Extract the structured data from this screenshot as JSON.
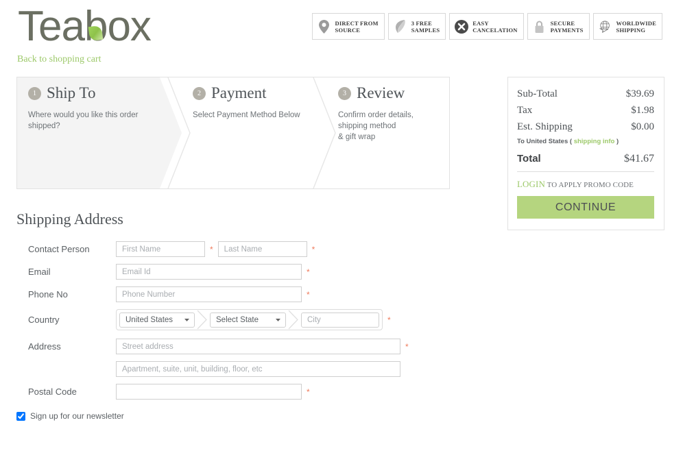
{
  "header": {
    "logo_text": "Teabox",
    "back_link": "Back to shopping cart",
    "badges": [
      {
        "icon": "map-pin-icon",
        "label": "DIRECT FROM\nSOURCE"
      },
      {
        "icon": "leaf-icon",
        "label": "3 FREE\nSAMPLES"
      },
      {
        "icon": "x-circle-icon",
        "label": "EASY\nCANCELATION"
      },
      {
        "icon": "lock-icon",
        "label": "SECURE\nPAYMENTS"
      },
      {
        "icon": "globe-plane-icon",
        "label": "WORLDWIDE\nSHIPPING"
      }
    ]
  },
  "steps": [
    {
      "num": "1",
      "title": "Ship To",
      "desc": "Where would you like this order shipped?"
    },
    {
      "num": "2",
      "title": "Payment",
      "desc": "Select Payment Method Below"
    },
    {
      "num": "3",
      "title": "Review",
      "desc": "Confirm order details,\nshipping method\n& gift wrap"
    }
  ],
  "summary": {
    "rows": [
      {
        "label": "Sub-Total",
        "value": "$39.69"
      },
      {
        "label": "Tax",
        "value": "$1.98"
      },
      {
        "label": "Est. Shipping",
        "value": "$0.00"
      }
    ],
    "ship_note_prefix": "To United States ( ",
    "ship_note_link": "shipping info",
    "ship_note_suffix": " )",
    "total_label": "Total",
    "total_value": "$41.67",
    "promo_login": "LOGIN",
    "promo_text": " TO APPLY PROMO CODE",
    "continue_label": "CONTINUE",
    "accent_green": "#b5d57f",
    "link_green": "#9dc96a"
  },
  "form": {
    "title": "Shipping Address",
    "contact_label": "Contact Person",
    "first_name_placeholder": "First Name",
    "first_name_value": "",
    "last_name_placeholder": "Last Name",
    "last_name_value": "",
    "email_label": "Email",
    "email_placeholder": "Email Id",
    "email_value": "",
    "phone_label": "Phone No",
    "phone_placeholder": "Phone Number",
    "phone_value": "",
    "country_label": "Country",
    "country_value": "United States",
    "state_value": "Select State",
    "city_placeholder": "City",
    "city_value": "",
    "address_label": "Address",
    "street_placeholder": "Street address",
    "street_value": "",
    "apartment_placeholder": "Apartment, suite, unit, building, floor, etc",
    "apartment_value": "",
    "postal_label": "Postal Code",
    "postal_placeholder": "",
    "postal_value": "",
    "required_mark": "*",
    "newsletter_label": "Sign up for our newsletter",
    "newsletter_checked": true
  }
}
